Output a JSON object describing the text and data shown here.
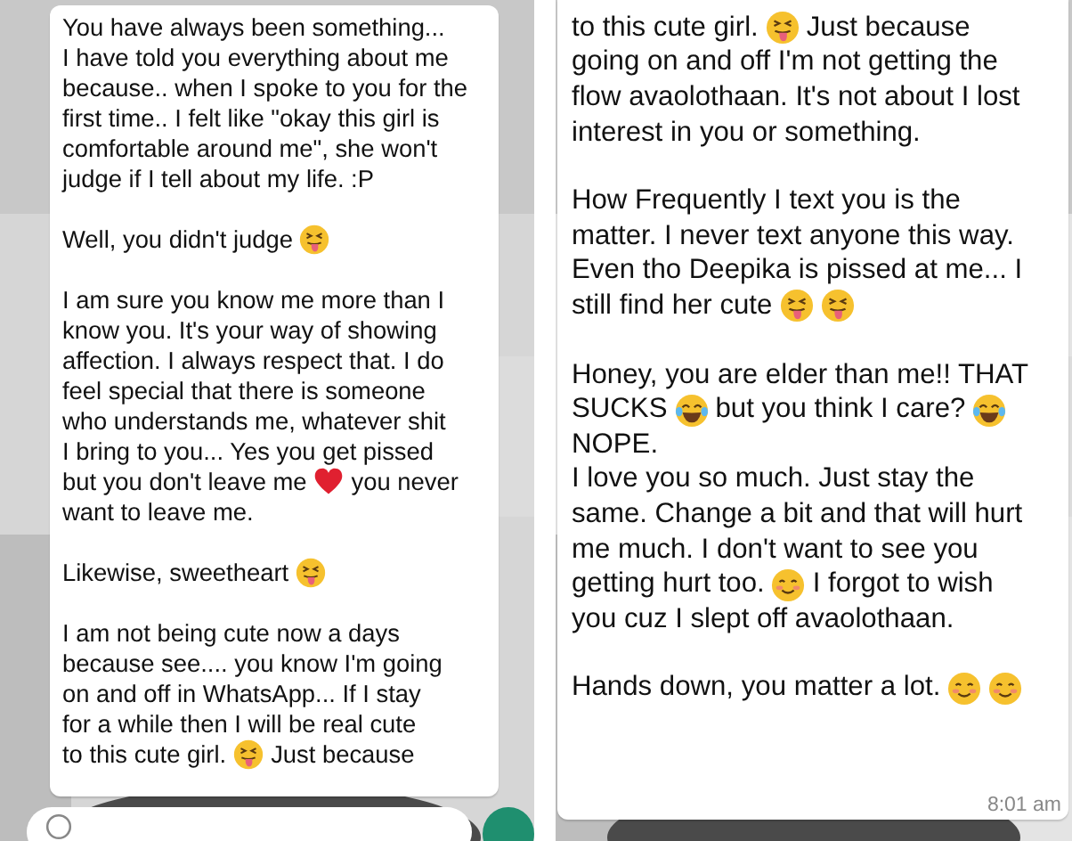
{
  "panels": [
    {
      "has_input_bar": true,
      "paragraphs": [
        [
          [
            {
              "kind": "text",
              "text": "You have always been something..."
            }
          ],
          [
            {
              "kind": "text",
              "text": "I have told you everything about me"
            }
          ],
          [
            {
              "kind": "text",
              "text": "because.. when I spoke to you for the"
            }
          ],
          [
            {
              "kind": "text",
              "text": "first time.. I felt like \"okay this girl is"
            }
          ],
          [
            {
              "kind": "text",
              "text": "comfortable around me\", she won't"
            }
          ],
          [
            {
              "kind": "text",
              "text": "judge if I tell about my life. :P"
            }
          ]
        ],
        [
          [
            {
              "kind": "text",
              "text": "Well, you didn't judge"
            },
            {
              "kind": "tongue"
            }
          ]
        ],
        [
          [
            {
              "kind": "text",
              "text": "I am sure you know me more than I"
            }
          ],
          [
            {
              "kind": "text",
              "text": "know you. It's your way of showing"
            }
          ],
          [
            {
              "kind": "text",
              "text": "affection. I always respect that. I do"
            }
          ],
          [
            {
              "kind": "text",
              "text": "feel special that there is someone"
            }
          ],
          [
            {
              "kind": "text",
              "text": "who understands me, whatever shit"
            }
          ],
          [
            {
              "kind": "text",
              "text": "I bring to you... Yes you get pissed"
            }
          ],
          [
            {
              "kind": "text",
              "text": "but you don't leave me"
            },
            {
              "kind": "heart"
            },
            {
              "kind": "text",
              "text": "you never"
            }
          ],
          [
            {
              "kind": "text",
              "text": "want to leave me."
            }
          ]
        ],
        [
          [
            {
              "kind": "text",
              "text": "Likewise, sweetheart"
            },
            {
              "kind": "tongue"
            }
          ]
        ],
        [
          [
            {
              "kind": "text",
              "text": "I am not being cute now a days"
            }
          ],
          [
            {
              "kind": "text",
              "text": "because see.... you know I'm going"
            }
          ],
          [
            {
              "kind": "text",
              "text": "on and off in WhatsApp... If I stay"
            }
          ],
          [
            {
              "kind": "text",
              "text": "for a while then I will be real cute"
            }
          ],
          [
            {
              "kind": "text",
              "text": "to this cute girl."
            },
            {
              "kind": "tongue"
            },
            {
              "kind": "text",
              "text": "Just because"
            }
          ]
        ]
      ]
    },
    {
      "has_input_bar": false,
      "time": "8:01 am",
      "paragraphs": [
        [
          [
            {
              "kind": "text",
              "text": "to this cute girl."
            },
            {
              "kind": "tongue"
            },
            {
              "kind": "text",
              "text": "Just because"
            }
          ],
          [
            {
              "kind": "text",
              "text": "going on and off I'm not getting the"
            }
          ],
          [
            {
              "kind": "text",
              "text": "flow avaolothaan. It's not about I lost"
            }
          ],
          [
            {
              "kind": "text",
              "text": "interest in you or something."
            }
          ]
        ],
        [
          [
            {
              "kind": "text",
              "text": "How Frequently I text you is the"
            }
          ],
          [
            {
              "kind": "text",
              "text": "matter. I never text anyone this way."
            }
          ],
          [
            {
              "kind": "text",
              "text": "Even tho Deepika is pissed at me... I"
            }
          ],
          [
            {
              "kind": "text",
              "text": "still find her cute"
            },
            {
              "kind": "tongue"
            },
            {
              "kind": "tongue"
            }
          ]
        ],
        [
          [
            {
              "kind": "text",
              "text": "Honey, you are elder than me!! THAT"
            }
          ],
          [
            {
              "kind": "text",
              "text": "SUCKS"
            },
            {
              "kind": "laugh"
            },
            {
              "kind": "text",
              "text": "but you think I care?"
            },
            {
              "kind": "laugh"
            }
          ],
          [
            {
              "kind": "text",
              "text": "NOPE."
            }
          ],
          [
            {
              "kind": "text",
              "text": "I love you so much. Just stay the"
            }
          ],
          [
            {
              "kind": "text",
              "text": "same. Change a bit and that will hurt"
            }
          ],
          [
            {
              "kind": "text",
              "text": "me much. I don't want to see you"
            }
          ],
          [
            {
              "kind": "text",
              "text": "getting hurt too."
            },
            {
              "kind": "smile"
            },
            {
              "kind": "text",
              "text": "I forgot to wish"
            }
          ],
          [
            {
              "kind": "text",
              "text": "you cuz I slept off avaolothaan."
            }
          ]
        ],
        [
          [
            {
              "kind": "text",
              "text": "Hands down, you matter a lot."
            },
            {
              "kind": "smile"
            },
            {
              "kind": "smile"
            }
          ]
        ]
      ]
    }
  ]
}
